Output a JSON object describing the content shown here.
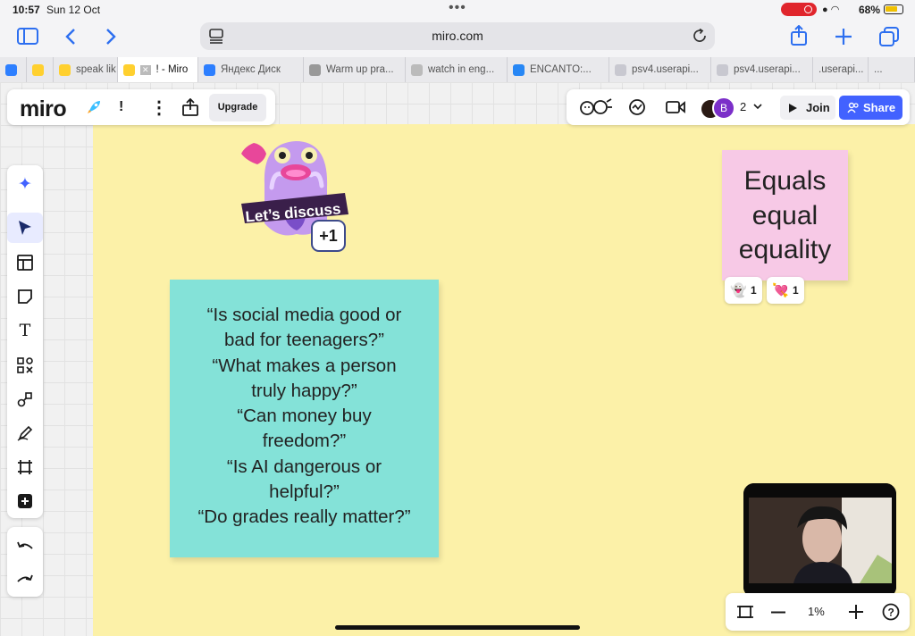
{
  "status": {
    "time": "10:57",
    "date": "Sun 12 Oct",
    "battery": "68%"
  },
  "browser": {
    "url": "miro.com",
    "tabs": [
      {
        "label": "",
        "favicon": "#2d7fff"
      },
      {
        "label": "",
        "favicon": "#ffd02f"
      },
      {
        "label": "speak lik",
        "favicon": "#ffd02f"
      },
      {
        "label": "! - Miro",
        "favicon": "#ffd02f",
        "active": true
      },
      {
        "label": "Яндекс Диск",
        "favicon": "#2d7fff"
      },
      {
        "label": "Warm up pra...",
        "favicon": "#999999"
      },
      {
        "label": "watch in eng...",
        "favicon": "#bbbbbb"
      },
      {
        "label": "ENCANTO:...",
        "favicon": "#2787f5"
      },
      {
        "label": "psv4.userapi...",
        "favicon": "#c8c8d0"
      },
      {
        "label": "psv4.userapi...",
        "favicon": "#c8c8d0"
      },
      {
        "label": ".userapi...",
        "favicon": ""
      },
      {
        "label": "...",
        "favicon": ""
      }
    ]
  },
  "board": {
    "logo": "miro",
    "board_name": "!",
    "upgrade": "Upgrade",
    "participant_count": "2",
    "avatar_initial": "B",
    "join": "Join",
    "share": "Share",
    "sticker_text": "Let’s discuss",
    "sticker_plus": "+1",
    "zoom": "1%"
  },
  "sticky_teal": {
    "lines": [
      "“Is social media good or",
      "bad for teenagers?”",
      "“What makes a person",
      "truly happy?”",
      "“Can money buy",
      "freedom?”",
      "“Is AI dangerous or",
      "helpful?”",
      "“Do grades really matter?”"
    ]
  },
  "sticky_pink": {
    "lines": [
      "Equals",
      "equal",
      "equality"
    ],
    "reactions": [
      {
        "icon": "ghost-icon",
        "count": "1"
      },
      {
        "icon": "heart-arrow-icon",
        "count": "1"
      }
    ]
  },
  "colors": {
    "accent": "#4262ff",
    "frame": "#fcf1a8",
    "teal_note": "#84e2d8",
    "pink_note": "#f7c9e6"
  }
}
